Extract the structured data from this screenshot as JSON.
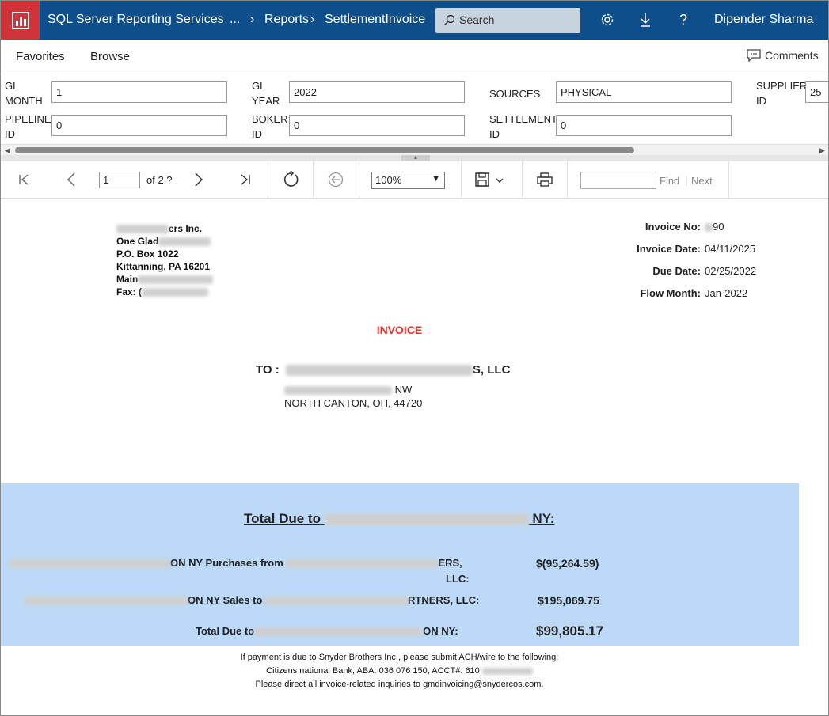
{
  "header": {
    "app_title": "SQL Server Reporting Services",
    "breadcrumb_ellipsis": "...",
    "breadcrumb_reports": "Reports",
    "breadcrumb_current": "SettlementInvoice",
    "search_placeholder": "Search",
    "user_name": "Dipender Sharma"
  },
  "nav": {
    "favorites": "Favorites",
    "browse": "Browse",
    "comments": "Comments"
  },
  "params": [
    {
      "label_line1": "GL",
      "label_line2": "MONTH",
      "value": "1"
    },
    {
      "label_line1": "GL",
      "label_line2": "YEAR",
      "value": "2022"
    },
    {
      "label_line1": "SOURCES",
      "label_line2": "",
      "value": "PHYSICAL"
    },
    {
      "label_line1": "SUPPLIER",
      "label_line2": "ID",
      "value": "25"
    },
    {
      "label_line1": "PIPELINE",
      "label_line2": "ID",
      "value": "0"
    },
    {
      "label_line1": "BOKER",
      "label_line2": "ID",
      "value": "0"
    },
    {
      "label_line1": "SETTLEMENT",
      "label_line2": "ID",
      "value": "0"
    }
  ],
  "toolbar": {
    "page_current": "1",
    "page_of": "of 2 ?",
    "zoom": "100%",
    "find_label": "Find",
    "separator": "|",
    "next_label": "Next"
  },
  "report": {
    "sender_lines": [
      "ers Inc.",
      "One Glad",
      "P.O. Box 1022",
      "Kittanning, PA 16201",
      "Main",
      "Fax: ("
    ],
    "invoice_no_label": "Invoice No:",
    "invoice_no_value": "90",
    "invoice_date_label": "Invoice Date:",
    "invoice_date_value": "04/11/2025",
    "due_date_label": "Due Date:",
    "due_date_value": "02/25/2022",
    "flow_month_label": "Flow Month:",
    "flow_month_value": "Jan-2022",
    "title": "INVOICE",
    "to_label": "TO :",
    "to_name_suffix": "S, LLC",
    "to_address_line1": "NW",
    "to_address_line2": "NORTH CANTON, OH, 44720",
    "total_due_heading_prefix": "Total Due to",
    "total_due_heading_suffix": "NY:",
    "purchases_text": "ON NY Purchases from",
    "purchases_suffix": "ERS,",
    "purchases_suffix2": "LLC:",
    "purchases_amount": "$(95,264.59)",
    "sales_text": "ON NY Sales to",
    "sales_suffix": "RTNERS, LLC:",
    "sales_amount": "$195,069.75",
    "total_due_prefix": "Total Due to",
    "total_due_suffix": "ON NY:",
    "total_due_amount": "$99,805.17",
    "footer_line1": "If payment is due to Snyder Brothers Inc., please submit ACH/wire to the following:",
    "footer_line2": "Citizens national Bank, ABA: 036 076 150, ACCT#: 610",
    "footer_line3": "Please direct all invoice-related inquiries to gmdinvoicing@snydercos.com."
  },
  "colors": {
    "topbar": "#0e4f8b",
    "logo": "#d13438",
    "invoice_title": "#e8312b",
    "total_box": "#bcdaf7"
  }
}
